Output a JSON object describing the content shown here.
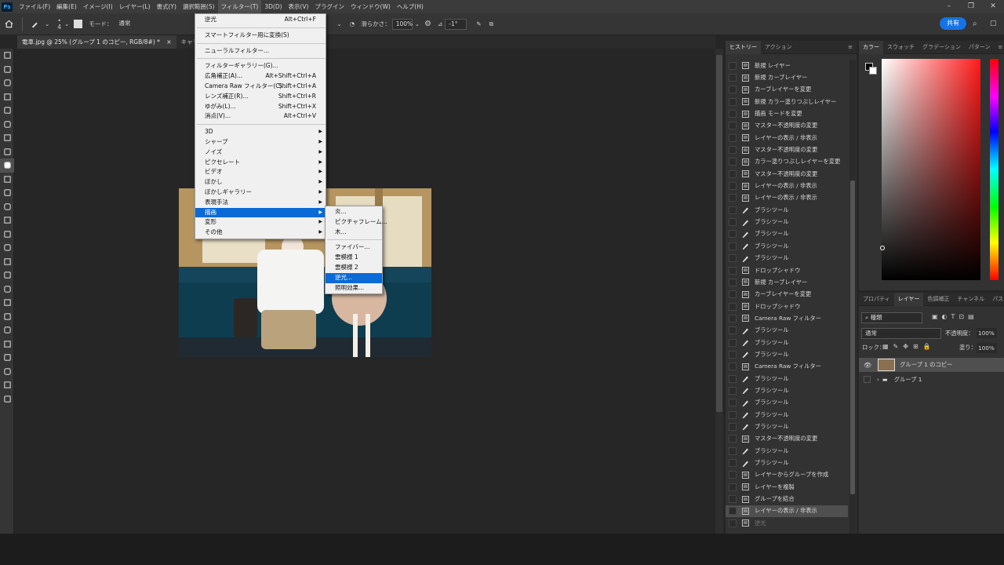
{
  "menubar": {
    "logo": "Ps",
    "items": [
      "ファイル(F)",
      "編集(E)",
      "イメージ(I)",
      "レイヤー(L)",
      "書式(Y)",
      "選択範囲(S)",
      "フィルター(T)",
      "3D(D)",
      "表示(V)",
      "プラグイン",
      "ウィンドウ(W)",
      "ヘルプ(H)"
    ],
    "active_index": 6
  },
  "window_controls": {
    "minimize": "–",
    "maximize": "❐",
    "close": "✕"
  },
  "options": {
    "brush_size": "4",
    "mode_label": "モード：",
    "mode_value": "通常",
    "smoothing_label": "滑らかさ：",
    "smoothing_value": "100%",
    "angle_label": "⊿",
    "angle_value": "-1°",
    "share": "共有"
  },
  "tabs": [
    "電車.jpg @ 25% (グループ 1 のコピー, RGB/8#) *",
    "キャラクター.p"
  ],
  "filter_menu": {
    "items": [
      {
        "label": "逆光",
        "shortcut": "Alt+Ctrl+F",
        "sub": false
      },
      {
        "sep": true
      },
      {
        "label": "スマートフィルター用に変換(S)",
        "shortcut": "",
        "sub": false
      },
      {
        "sep": true
      },
      {
        "label": "ニューラルフィルター...",
        "shortcut": "",
        "sub": false
      },
      {
        "sep": true
      },
      {
        "label": "フィルターギャラリー(G)...",
        "shortcut": "",
        "sub": false
      },
      {
        "label": "広角補正(A)...",
        "shortcut": "Alt+Shift+Ctrl+A",
        "sub": false
      },
      {
        "label": "Camera Raw フィルター(C)...",
        "shortcut": "Shift+Ctrl+A",
        "sub": false
      },
      {
        "label": "レンズ補正(R)...",
        "shortcut": "Shift+Ctrl+R",
        "sub": false
      },
      {
        "label": "ゆがみ(L)...",
        "shortcut": "Shift+Ctrl+X",
        "sub": false
      },
      {
        "label": "消点(V)...",
        "shortcut": "Alt+Ctrl+V",
        "sub": false
      },
      {
        "sep": true
      },
      {
        "label": "3D",
        "shortcut": "",
        "sub": true
      },
      {
        "label": "シャープ",
        "shortcut": "",
        "sub": true
      },
      {
        "label": "ノイズ",
        "shortcut": "",
        "sub": true
      },
      {
        "label": "ピクセレート",
        "shortcut": "",
        "sub": true
      },
      {
        "label": "ビデオ",
        "shortcut": "",
        "sub": true
      },
      {
        "label": "ぼかし",
        "shortcut": "",
        "sub": true
      },
      {
        "label": "ぼかしギャラリー",
        "shortcut": "",
        "sub": true
      },
      {
        "label": "表現手法",
        "shortcut": "",
        "sub": true
      },
      {
        "label": "描画",
        "shortcut": "",
        "sub": true,
        "highlight": true
      },
      {
        "label": "変形",
        "shortcut": "",
        "sub": true
      },
      {
        "label": "その他",
        "shortcut": "",
        "sub": true
      }
    ]
  },
  "render_submenu": {
    "items": [
      {
        "label": "炎..."
      },
      {
        "label": "ピクチャフレーム..."
      },
      {
        "label": "木..."
      },
      {
        "sep": true
      },
      {
        "label": "ファイバー..."
      },
      {
        "label": "雲模様 1"
      },
      {
        "label": "雲模様 2"
      },
      {
        "label": "逆光...",
        "highlight": true
      },
      {
        "label": "照明効果..."
      }
    ]
  },
  "history": {
    "tabs": [
      "ヒストリー",
      "アクション"
    ],
    "items": [
      {
        "label": "新規 レイヤー",
        "icon": "doc"
      },
      {
        "label": "新規 カーブレイヤー",
        "icon": "doc"
      },
      {
        "label": "カーブレイヤーを変更",
        "icon": "doc"
      },
      {
        "label": "新規 カラー塗りつぶしレイヤー",
        "icon": "doc"
      },
      {
        "label": "描画 モードを変更",
        "icon": "doc"
      },
      {
        "label": "マスター不透明度の変更",
        "icon": "doc"
      },
      {
        "label": "レイヤーの表示 / 非表示",
        "icon": "doc"
      },
      {
        "label": "マスター不透明度の変更",
        "icon": "doc"
      },
      {
        "label": "カラー塗りつぶしレイヤーを変更",
        "icon": "doc"
      },
      {
        "label": "マスター不透明度の変更",
        "icon": "doc"
      },
      {
        "label": "レイヤーの表示 / 非表示",
        "icon": "doc"
      },
      {
        "label": "レイヤーの表示 / 非表示",
        "icon": "doc"
      },
      {
        "label": "ブラシツール",
        "icon": "brush"
      },
      {
        "label": "ブラシツール",
        "icon": "brush"
      },
      {
        "label": "ブラシツール",
        "icon": "brush"
      },
      {
        "label": "ブラシツール",
        "icon": "brush"
      },
      {
        "label": "ブラシツール",
        "icon": "brush"
      },
      {
        "label": "ドロップシャドウ",
        "icon": "doc"
      },
      {
        "label": "新規 カーブレイヤー",
        "icon": "doc"
      },
      {
        "label": "カーブレイヤーを変更",
        "icon": "doc"
      },
      {
        "label": "ドロップシャドウ",
        "icon": "doc"
      },
      {
        "label": "Camera Raw フィルター",
        "icon": "doc"
      },
      {
        "label": "ブラシツール",
        "icon": "brush"
      },
      {
        "label": "ブラシツール",
        "icon": "brush"
      },
      {
        "label": "ブラシツール",
        "icon": "brush"
      },
      {
        "label": "Camera Raw フィルター",
        "icon": "doc"
      },
      {
        "label": "ブラシツール",
        "icon": "brush"
      },
      {
        "label": "ブラシツール",
        "icon": "brush"
      },
      {
        "label": "ブラシツール",
        "icon": "brush"
      },
      {
        "label": "ブラシツール",
        "icon": "brush"
      },
      {
        "label": "ブラシツール",
        "icon": "brush"
      },
      {
        "label": "マスター不透明度の変更",
        "icon": "doc"
      },
      {
        "label": "ブラシツール",
        "icon": "brush"
      },
      {
        "label": "ブラシツール",
        "icon": "brush"
      },
      {
        "label": "レイヤーからグループを作成",
        "icon": "doc"
      },
      {
        "label": "レイヤーを複製",
        "icon": "doc"
      },
      {
        "label": "グループを結合",
        "icon": "doc"
      },
      {
        "label": "レイヤーの表示 / 非表示",
        "icon": "doc",
        "selected": true
      },
      {
        "label": "逆光",
        "icon": "doc",
        "dim": true
      }
    ]
  },
  "color_panel": {
    "tabs": [
      "カラー",
      "スウォッチ",
      "グラデーション",
      "パターン"
    ]
  },
  "layers_panel": {
    "tabs": [
      "プロパティ",
      "レイヤー",
      "色調補正",
      "チャンネル",
      "パス"
    ],
    "filter_kind": "種類",
    "blend_mode": "通常",
    "opacity_label": "不透明度：",
    "opacity_value": "100%",
    "lock_label": "ロック：",
    "fill_label": "塗り：",
    "fill_value": "100%",
    "layers": [
      {
        "name": "グループ 1 のコピー",
        "selected": true
      },
      {
        "name": "グループ 1",
        "selected": false
      }
    ]
  },
  "colors": {
    "accent": "#0a6ad6",
    "share": "#1473e6"
  }
}
